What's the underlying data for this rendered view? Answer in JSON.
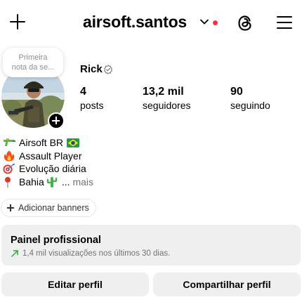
{
  "header": {
    "username": "airsoft.santos",
    "notification_dot_color": "#ff3040"
  },
  "note": {
    "text_line1": "Primeira",
    "text_line2": "nota da se..."
  },
  "profile": {
    "display_name": "Rick",
    "stats": {
      "posts_count": "4",
      "posts_label": "posts",
      "followers_count": "13,2 mil",
      "followers_label": "seguidores",
      "following_count": "90",
      "following_label": "seguindo"
    },
    "bio": [
      {
        "icon": "water-gun-icon",
        "text": "Airsoft BR",
        "trail_icon": "brazil-flag-icon"
      },
      {
        "icon": "fire-icon",
        "text": "Assault Player"
      },
      {
        "icon": "target-icon",
        "text": "Evolução diária"
      },
      {
        "icon": "pin-icon",
        "text": "Bahia",
        "trail_icon": "cactus-icon",
        "ellipsis": "...",
        "more": "mais"
      }
    ]
  },
  "banners_chip": {
    "label": "Adicionar banners"
  },
  "pro_panel": {
    "title": "Painel profissional",
    "subtitle": "1,4 mil visualizações nos últimos 30 dias.",
    "trend_color": "#2ba640"
  },
  "actions": {
    "edit_label": "Editar perfil",
    "share_label": "Compartilhar perfil"
  }
}
